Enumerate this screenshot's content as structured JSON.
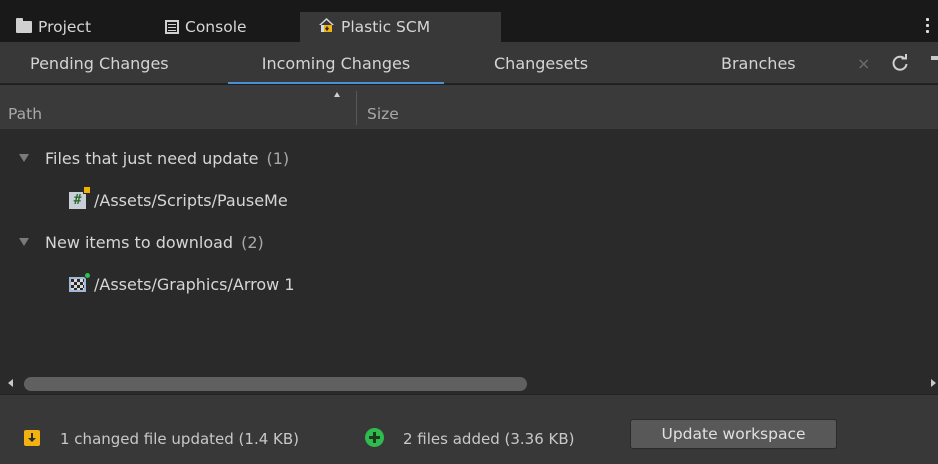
{
  "window_tabs": [
    {
      "label": "Project",
      "icon": "folder-icon"
    },
    {
      "label": "Console",
      "icon": "console-icon"
    },
    {
      "label": "Plastic SCM",
      "icon": "plastic-scm-icon",
      "active": true
    }
  ],
  "sub_tabs": [
    {
      "label": "Pending Changes"
    },
    {
      "label": "Incoming Changes",
      "active": true
    },
    {
      "label": "Changesets"
    },
    {
      "label": "Branches"
    }
  ],
  "columns": {
    "path": "Path",
    "size": "Size"
  },
  "tree": {
    "groups": [
      {
        "label": "Files that just need update",
        "count": "(1)",
        "items": [
          {
            "path": "/Assets/Scripts/PauseMe",
            "icon": "csharp-script-icon"
          }
        ]
      },
      {
        "label": "New items to download",
        "count": "(2)",
        "items": [
          {
            "path": "/Assets/Graphics/Arrow 1",
            "icon": "image-file-icon"
          }
        ]
      }
    ]
  },
  "status": {
    "updated_text": "1 changed file updated (1.4 KB)",
    "added_text": "2 files added (3.36 KB)",
    "update_button": "Update workspace"
  },
  "colors": {
    "accent_underline": "#4a90d9",
    "update_icon": "#f2b20f",
    "add_icon": "#2ebc4f"
  }
}
